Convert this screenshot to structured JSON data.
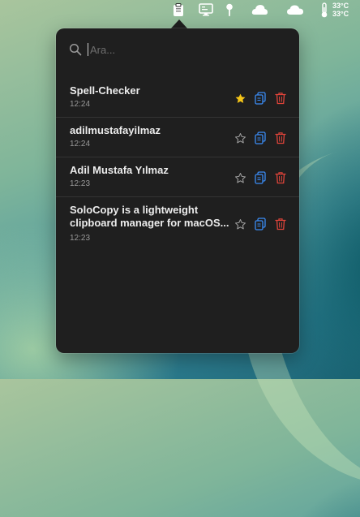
{
  "menubar": {
    "icons": [
      "clipboard-icon",
      "display-icon",
      "pin-icon",
      "cloud-sun-icon",
      "cloud-icon",
      "thermometer-icon"
    ],
    "temp_top": "33°C",
    "temp_bottom": "33°C"
  },
  "popover": {
    "search": {
      "placeholder": "Ara...",
      "value": ""
    },
    "items": [
      {
        "text": "Spell-Checker",
        "time": "12:24",
        "favorite": true
      },
      {
        "text": "adilmustafayilmaz",
        "time": "12:24",
        "favorite": false
      },
      {
        "text": "Adil Mustafa Yılmaz",
        "time": "12:23",
        "favorite": false
      },
      {
        "text": "SoloCopy is a lightweight clipboard manager for macOS...",
        "time": "12:23",
        "favorite": false
      }
    ],
    "action_icons": [
      "star-icon",
      "copy-icon",
      "trash-icon"
    ],
    "colors": {
      "favorite": "#f5c518",
      "copy": "#3b8cf5",
      "delete": "#e0443a",
      "star_outline": "#9a9a9a"
    }
  }
}
